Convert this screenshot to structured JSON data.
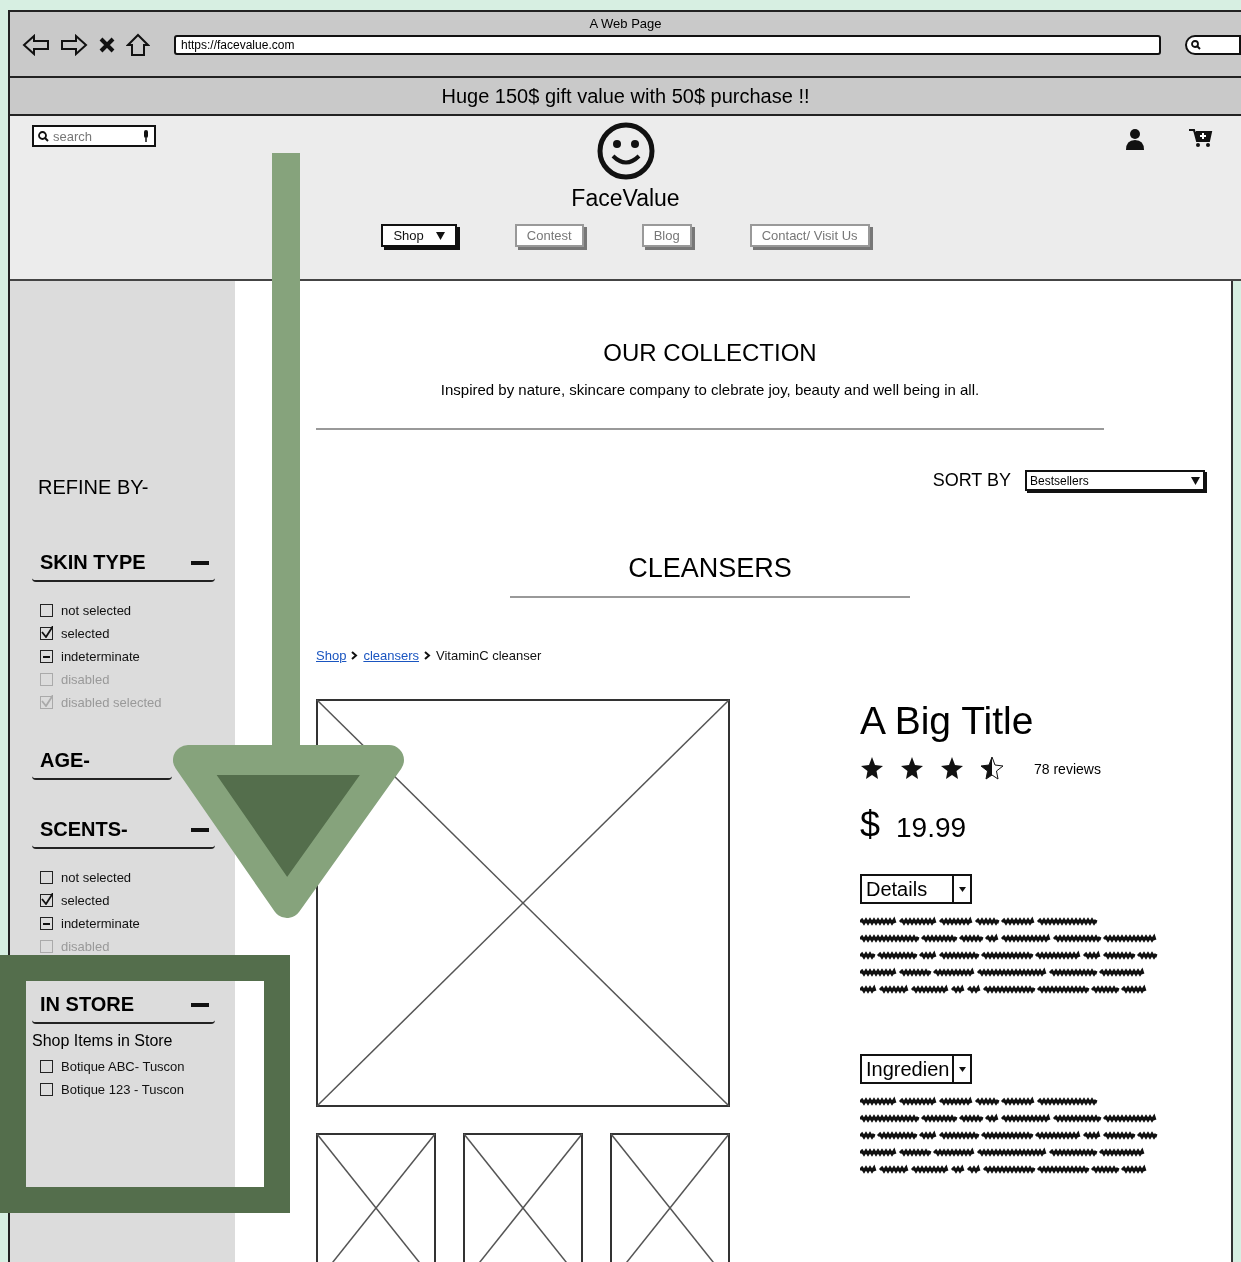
{
  "window": {
    "title": "A Web Page"
  },
  "browser": {
    "url": "https://facevalue.com"
  },
  "banner": "Huge 150$ gift value with 50$ purchase !!",
  "header": {
    "search": {
      "placeholder": "search"
    },
    "brand": "FaceValue",
    "nav": [
      {
        "label": "Shop",
        "kind": "dropdown",
        "selected": true
      },
      {
        "label": "Contest",
        "kind": "link",
        "selected": false
      },
      {
        "label": "Blog",
        "kind": "link",
        "selected": false
      },
      {
        "label": "Contact/ Visit Us",
        "kind": "link",
        "selected": false
      }
    ]
  },
  "sidebar": {
    "title": "REFINE BY-",
    "sections": [
      {
        "title": "SKIN TYPE",
        "expanded": true,
        "options": [
          {
            "label": "not selected",
            "checked": false,
            "indeterminate": false,
            "disabled": false
          },
          {
            "label": "selected",
            "checked": true,
            "indeterminate": false,
            "disabled": false
          },
          {
            "label": "indeterminate",
            "checked": false,
            "indeterminate": true,
            "disabled": false
          },
          {
            "label": "disabled",
            "checked": false,
            "indeterminate": false,
            "disabled": true
          },
          {
            "label": "disabled selected",
            "checked": true,
            "indeterminate": false,
            "disabled": true
          }
        ]
      },
      {
        "title": "AGE-",
        "expanded": false
      },
      {
        "title": "SCENTS-",
        "expanded": true,
        "options": [
          {
            "label": "not selected",
            "checked": false,
            "indeterminate": false,
            "disabled": false
          },
          {
            "label": "selected",
            "checked": true,
            "indeterminate": false,
            "disabled": false
          },
          {
            "label": "indeterminate",
            "checked": false,
            "indeterminate": true,
            "disabled": false
          },
          {
            "label": "disabled",
            "checked": false,
            "indeterminate": false,
            "disabled": true
          }
        ]
      },
      {
        "title": "IN STORE",
        "expanded": true,
        "note": "Shop Items in Store",
        "options": [
          {
            "label": "Botique ABC- Tuscon",
            "checked": false,
            "indeterminate": false,
            "disabled": false
          },
          {
            "label": "Botique 123 - Tuscon",
            "checked": false,
            "indeterminate": false,
            "disabled": false
          }
        ]
      }
    ]
  },
  "collection": {
    "title": "OUR COLLECTION",
    "subtitle": "Inspired by nature, skincare company to clebrate joy, beauty and well being in all."
  },
  "sort": {
    "label": "SORT BY",
    "value": "Bestsellers"
  },
  "category": "CLEANSERS",
  "breadcrumb": [
    {
      "label": "Shop",
      "link": true
    },
    {
      "label": "cleansers",
      "link": true
    },
    {
      "label": "VitaminC cleanser",
      "link": false
    }
  ],
  "product": {
    "title": "A Big Title",
    "stars": 3.5,
    "reviews": "78 reviews",
    "currency": "$",
    "price": "19.99",
    "sections": [
      {
        "label": "Details"
      },
      {
        "label": "Ingredien"
      }
    ]
  }
}
